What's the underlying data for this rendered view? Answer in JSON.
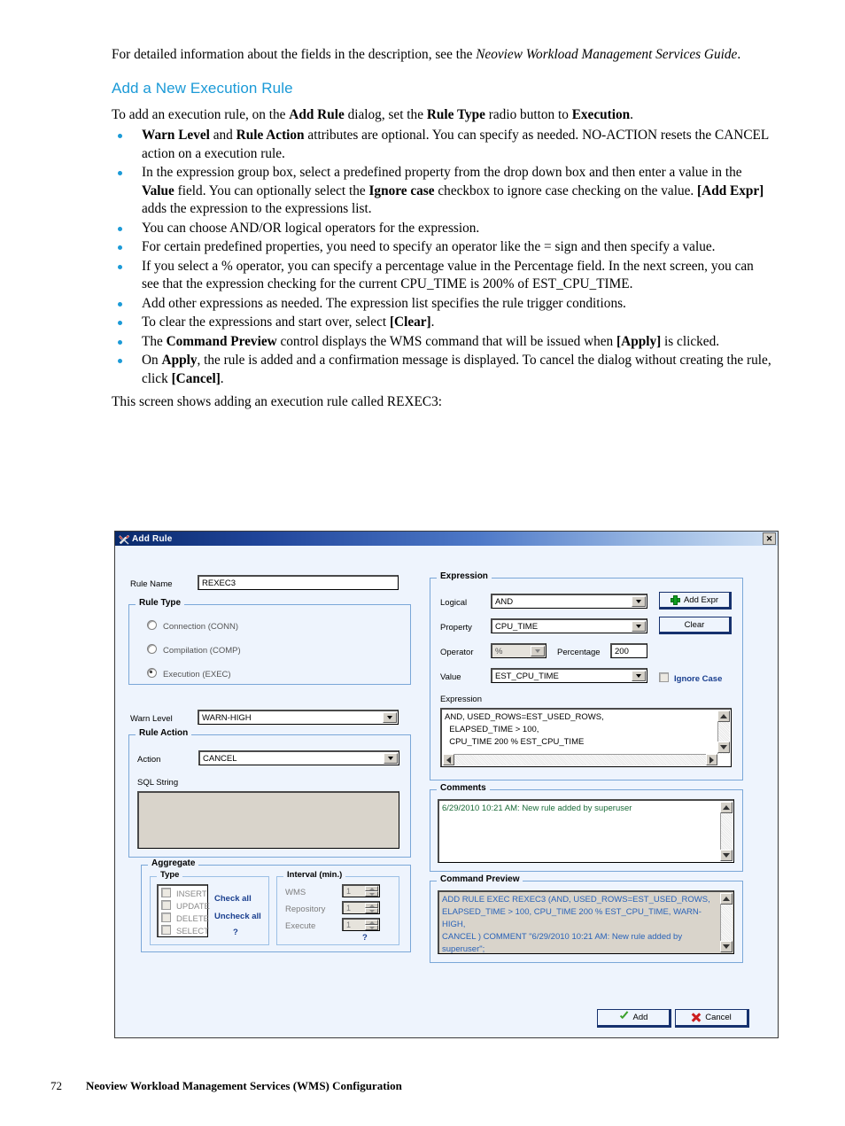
{
  "document": {
    "intro": {
      "before_italic": "For detailed information about the fields in the description, see the ",
      "italic": "Neoview Workload Management Services Guide",
      "after_italic": "."
    },
    "section_heading": "Add a New Execution Rule",
    "lead_paragraph": {
      "p1": "To add an execution rule, on the ",
      "b1": "Add Rule",
      "p2": " dialog, set the ",
      "b2": "Rule Type",
      "p3": " radio button to ",
      "b3": "Execution",
      "p4": "."
    },
    "bullets": [
      {
        "segments": [
          {
            "text": "Warn Level",
            "bold": true
          },
          {
            "text": " and ",
            "bold": false
          },
          {
            "text": "Rule Action",
            "bold": true
          },
          {
            "text": " attributes are optional. You can specify as needed. NO-ACTION resets the CANCEL action on a execution rule.",
            "bold": false
          }
        ]
      },
      {
        "segments": [
          {
            "text": "In the expression group box, select a predefined property from the drop down box and then enter a value in the ",
            "bold": false
          },
          {
            "text": "Value",
            "bold": true
          },
          {
            "text": " field. You can optionally select the ",
            "bold": false
          },
          {
            "text": "Ignore case",
            "bold": true
          },
          {
            "text": " checkbox to ignore case checking on the value. ",
            "bold": false
          },
          {
            "text": "[Add Expr]",
            "bold": true
          },
          {
            "text": " adds the expression to the expressions list.",
            "bold": false
          }
        ]
      },
      {
        "segments": [
          {
            "text": "You can choose AND/OR logical operators for the expression.",
            "bold": false
          }
        ]
      },
      {
        "segments": [
          {
            "text": "For certain predefined properties, you need to specify an operator like the = sign and then specify a value.",
            "bold": false
          }
        ]
      },
      {
        "segments": [
          {
            "text": "If you select a % operator, you can specify a percentage value in the Percentage field. In the next screen, you can see that the expression checking for the current CPU_TIME is 200% of EST_CPU_TIME.",
            "bold": false
          }
        ]
      },
      {
        "segments": [
          {
            "text": "Add other expressions as needed. The expression list specifies the rule trigger conditions.",
            "bold": false
          }
        ]
      },
      {
        "segments": [
          {
            "text": "To clear the expressions and start over, select ",
            "bold": false
          },
          {
            "text": "[Clear]",
            "bold": true
          },
          {
            "text": ".",
            "bold": false
          }
        ]
      },
      {
        "segments": [
          {
            "text": "The ",
            "bold": false
          },
          {
            "text": "Command Preview",
            "bold": true
          },
          {
            "text": " control displays the WMS command that will be issued when ",
            "bold": false
          },
          {
            "text": "[Apply]",
            "bold": true
          },
          {
            "text": " is clicked.",
            "bold": false
          }
        ]
      },
      {
        "segments": [
          {
            "text": "On ",
            "bold": false
          },
          {
            "text": "Apply",
            "bold": true
          },
          {
            "text": ", the rule is added and a confirmation message is displayed. To cancel the dialog without creating the rule, click ",
            "bold": false
          },
          {
            "text": "[Cancel]",
            "bold": true
          },
          {
            "text": ".",
            "bold": false
          }
        ]
      }
    ],
    "tail_paragraph": "This screen shows adding an execution rule called REXEC3:",
    "footer": {
      "page_number": "72",
      "footer_title": "Neoview Workload Management Services (WMS) Configuration"
    }
  },
  "dialog": {
    "title": "Add Rule",
    "close_label": "✕",
    "rule_name": {
      "label": "Rule Name",
      "value": "REXEC3"
    },
    "rule_type": {
      "legend": "Rule Type",
      "options": [
        {
          "label": "Connection (CONN)",
          "selected": false
        },
        {
          "label": "Compilation (COMP)",
          "selected": false
        },
        {
          "label": "Execution (EXEC)",
          "selected": true
        }
      ]
    },
    "warn_level": {
      "label": "Warn Level",
      "value": "WARN-HIGH"
    },
    "rule_action": {
      "legend": "Rule Action",
      "action_label": "Action",
      "action_value": "CANCEL",
      "sql_string_label": "SQL String",
      "sql_string_value": ""
    },
    "aggregate": {
      "legend": "Aggregate",
      "type": {
        "legend": "Type",
        "items": [
          "INSERT",
          "UPDATE",
          "DELETE",
          "SELECT"
        ],
        "check_all": "Check all",
        "uncheck_all": "Uncheck all",
        "help": "?"
      },
      "interval": {
        "legend": "Interval (min.)",
        "rows": [
          {
            "label": "WMS",
            "value": "1"
          },
          {
            "label": "Repository",
            "value": "1"
          },
          {
            "label": "Execute",
            "value": "1"
          }
        ],
        "help": "?"
      }
    },
    "expression": {
      "legend": "Expression",
      "logical_label": "Logical",
      "logical_value": "AND",
      "property_label": "Property",
      "property_value": "CPU_TIME",
      "operator_label": "Operator",
      "operator_value": "%",
      "percentage_label": "Percentage",
      "percentage_value": "200",
      "value_label": "Value",
      "value_value": "EST_CPU_TIME",
      "ignore_case_label": "Ignore Case",
      "add_expr_label": "Add Expr",
      "clear_label": "Clear",
      "list_label": "Expression",
      "list_lines": [
        "AND, USED_ROWS=EST_USED_ROWS,",
        "  ELAPSED_TIME > 100,",
        "  CPU_TIME 200 % EST_CPU_TIME"
      ]
    },
    "comments": {
      "legend": "Comments",
      "lines": [
        "6/29/2010 10:21 AM: New rule added by superuser"
      ]
    },
    "command_preview": {
      "legend": "Command Preview",
      "lines": [
        "ADD RULE EXEC REXEC3 (AND, USED_ROWS=EST_USED_ROWS,",
        "ELAPSED_TIME > 100,  CPU_TIME 200 % EST_CPU_TIME, WARN-HIGH,",
        "CANCEL ) COMMENT \"6/29/2010 10:21 AM: New rule added by superuser\";"
      ]
    },
    "buttons": {
      "add": "Add",
      "cancel": "Cancel"
    },
    "colors": {
      "heading_blue": "#1b9ad7",
      "dialog_bg": "#eef4fd",
      "group_border": "#7aa7d8",
      "titlebar_dark": "#0a2a6b",
      "comment_green": "#1a6b38",
      "preview_blue": "#2a63b8"
    }
  }
}
